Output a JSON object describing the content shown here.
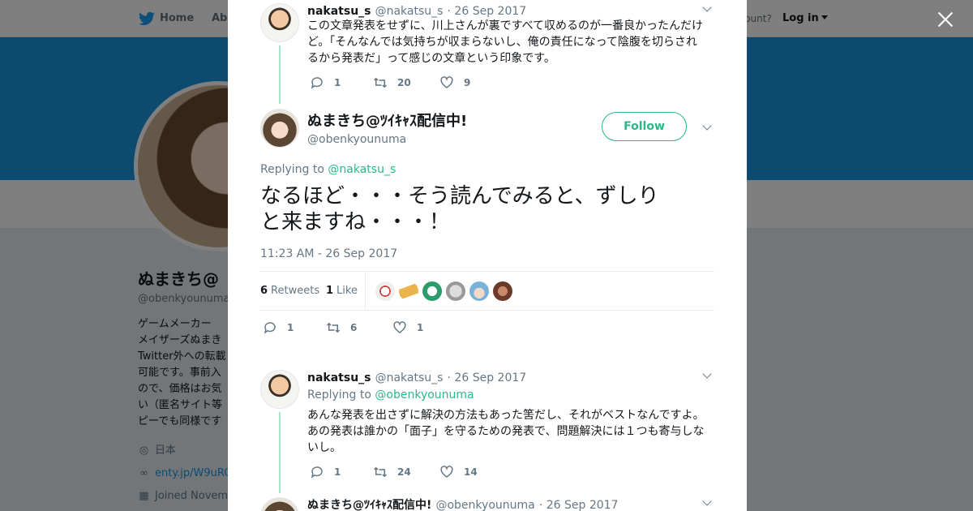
{
  "topnav": {
    "home_label": "Home",
    "about_label": "Abo",
    "have_account": "ccount?",
    "login_label": "Log in"
  },
  "profile": {
    "name": "ぬまきち@",
    "handle": "@obenkyounuma",
    "bio_lines": [
      "ゲームメーカー",
      "メイザーズぬまき",
      "Twitter外への転載",
      "可能です。事前入",
      "ので、価格はお気",
      "い（匿名サイト等",
      "ピーでも同様です"
    ],
    "location": "日本",
    "link": "enty.jp/W9uRC",
    "joined": "Joined Novem"
  },
  "thread": {
    "parent1": {
      "name": "nakatsu_s",
      "handle": "@nakatsu_s",
      "date": "· 26 Sep 2017",
      "text_lines": [
        "この文章発表をせずに、川上さんが裏ですべて収めるのが一番良かったんだけ",
        "ど。「そんなんでは気持ちが収まらないし、俺の責任になって陰腹を切らされ",
        "るから発表だ」って感じの文章という印象です。"
      ],
      "replies": "1",
      "retweets": "20",
      "likes": "9"
    },
    "main": {
      "name": "ぬまきち@ﾂｲｷｬｽ配信中!",
      "handle": "@obenkyounuma",
      "follow_label": "Follow",
      "replying_prefix": "Replying to",
      "replying_mention": "@nakatsu_s",
      "text_line1": "なるほど・・・そう読んでみると、ずしり",
      "text_line2": "と来ますね・・・！",
      "time": "11:23 AM - 26 Sep 2017",
      "retweets_count": "6",
      "retweets_label": "Retweets",
      "likes_count": "1",
      "likes_label": "Like",
      "replies": "1",
      "retweets": "6",
      "likes": "1"
    },
    "reply1": {
      "name": "nakatsu_s",
      "handle": "@nakatsu_s",
      "date": "· 26 Sep 2017",
      "replying_prefix": "Replying to",
      "replying_mention": "@obenkyounuma",
      "text_lines": [
        "あんな発表を出さずに解決の方法もあった筈だし、それがベストなんですよ。",
        "あの発表は誰かの「面子」を守るための発表で、問題解決には１つも寄与しな",
        "いし。"
      ],
      "replies": "1",
      "retweets": "24",
      "likes": "14"
    },
    "reply2": {
      "name": "ぬまきち@ﾂｲｷｬｽ配信中!",
      "handle": "@obenkyounuma",
      "date": "· 26 Sep 2017"
    }
  },
  "colors": {
    "accent_green": "#2bb789",
    "thread_line": "#a6e3c8",
    "banner_blue": "#1b95e0"
  },
  "icons": [
    "twitter-bird-icon",
    "reply-icon",
    "retweet-icon",
    "heart-icon",
    "chevron-down-icon",
    "close-icon",
    "location-icon",
    "link-icon",
    "calendar-icon"
  ]
}
